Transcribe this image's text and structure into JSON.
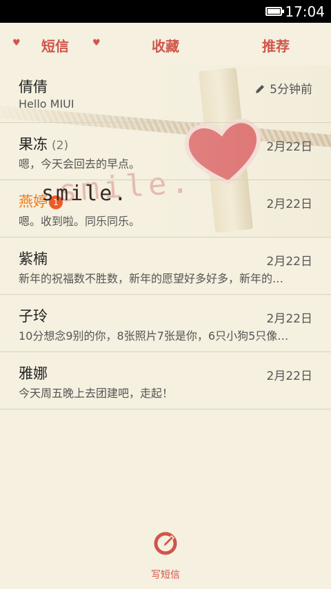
{
  "status_bar": {
    "time": "17:04"
  },
  "tabs": [
    {
      "label": "短信"
    },
    {
      "label": "收藏"
    },
    {
      "label": "推荐"
    }
  ],
  "wallpaper_text": "smile.",
  "threads": [
    {
      "name": "倩倩",
      "count": "",
      "snippet": "Hello MIUI",
      "time": "5分钟前",
      "draft": true,
      "unread_badge": ""
    },
    {
      "name": "果冻",
      "count": "(2)",
      "snippet": "嗯，今天会回去的早点。",
      "time": "2月22日",
      "draft": false,
      "unread_badge": ""
    },
    {
      "name": "燕婷",
      "count": "",
      "snippet": "嗯。收到啦。同乐同乐。",
      "time": "2月22日",
      "draft": false,
      "unread_badge": "1"
    },
    {
      "name": "紫楠",
      "count": "",
      "snippet": "新年的祝福数不胜数，新年的愿望好多好多，新年的…",
      "time": "2月22日",
      "draft": false,
      "unread_badge": ""
    },
    {
      "name": "子玲",
      "count": "",
      "snippet": "10分想念9别的你，8张照片7张是你，6只小狗5只像…",
      "time": "2月22日",
      "draft": false,
      "unread_badge": ""
    },
    {
      "name": "雅娜",
      "count": "",
      "snippet": "今天周五晚上去团建吧，走起！",
      "time": "2月22日",
      "draft": false,
      "unread_badge": ""
    }
  ],
  "compose": {
    "label": "写短信"
  },
  "colors": {
    "accent": "#d0554b",
    "unread_name": "#f07a1a",
    "background": "#f5f0df"
  }
}
